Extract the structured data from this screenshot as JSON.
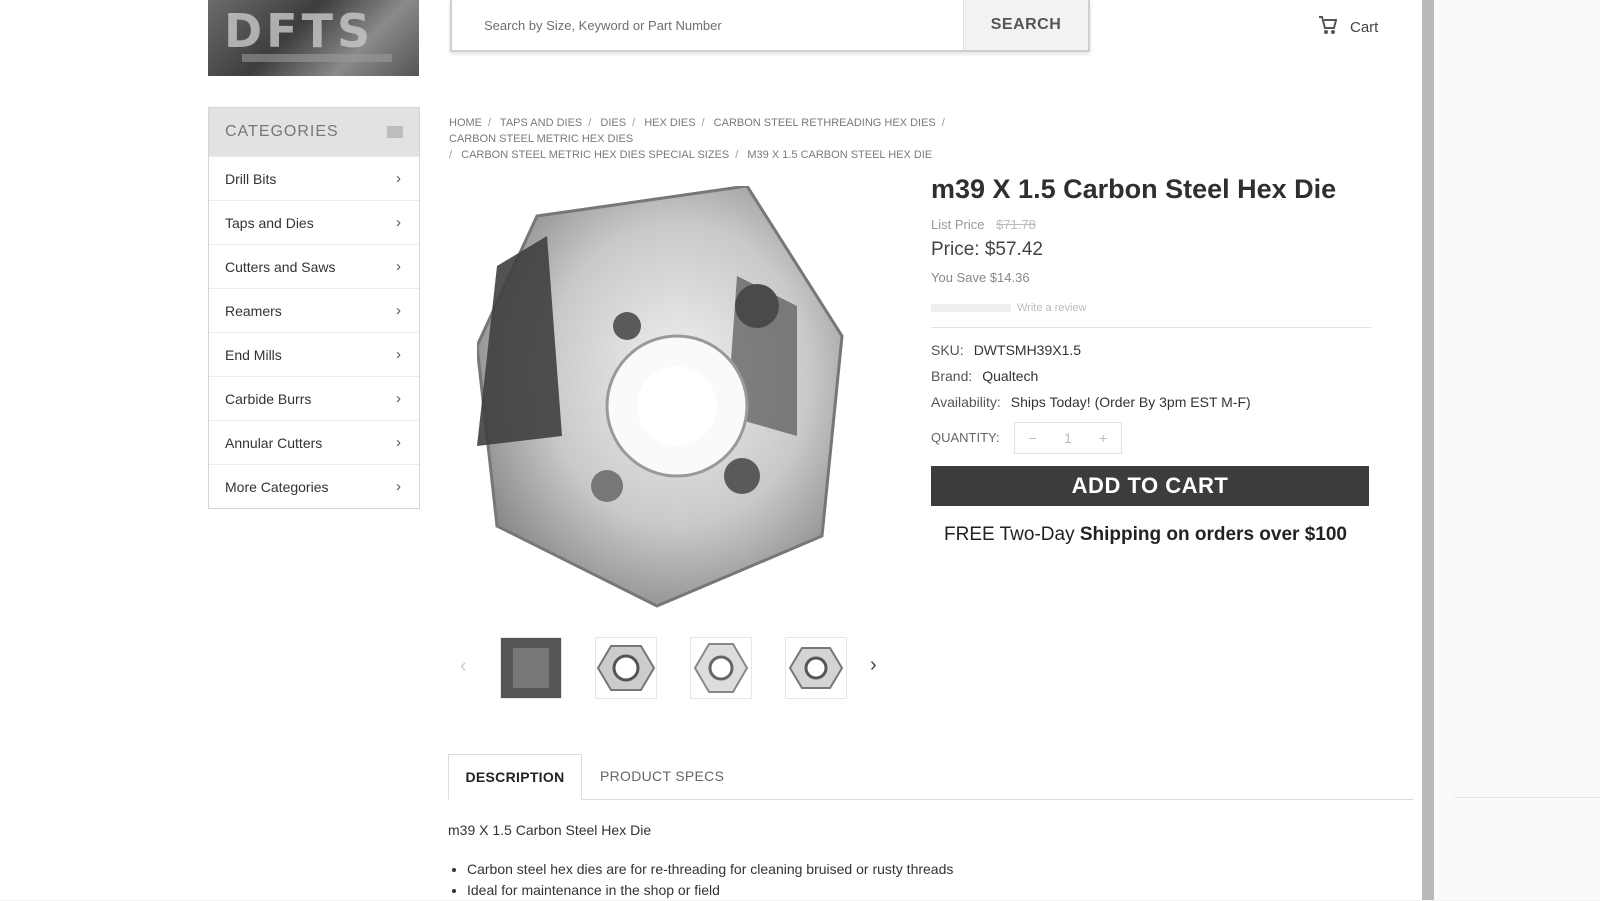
{
  "header": {
    "logo_text": "DFTS",
    "search": {
      "placeholder": "Search by Size, Keyword or Part Number",
      "button_label": "SEARCH"
    },
    "cart_label": "Cart"
  },
  "sidebar": {
    "title": "CATEGORIES",
    "items": [
      {
        "label": "Drill Bits"
      },
      {
        "label": "Taps and Dies"
      },
      {
        "label": "Cutters and Saws"
      },
      {
        "label": "Reamers"
      },
      {
        "label": "End Mills"
      },
      {
        "label": "Carbide Burrs"
      },
      {
        "label": "Annular Cutters"
      },
      {
        "label": "More Categories"
      }
    ]
  },
  "breadcrumb": [
    "Home",
    "Taps and Dies",
    "Dies",
    "Hex Dies",
    "Carbon Steel Rethreading Hex Dies",
    "Carbon Steel Metric Hex Dies",
    "Carbon Steel Metric Hex Dies Special Sizes",
    "M39 X 1.5 Carbon Steel Hex Die"
  ],
  "product": {
    "title": "m39 X 1.5 Carbon Steel Hex Die",
    "list_price_label": "List Price",
    "list_price_value": "$71.78",
    "price": "Price: $57.42",
    "you_save": "You Save $14.36",
    "reviews_link": "Write a review",
    "sku_label": "SKU:",
    "sku": "DWTSMH39X1.5",
    "brand_label": "Brand:",
    "brand": "Qualtech",
    "availability_label": "Availability:",
    "availability": "Ships Today! (Order By 3pm EST M-F)",
    "quantity_label": "QUANTITY:",
    "quantity": "1",
    "add_to_cart": "ADD TO CART",
    "free_shipping_prefix": "FREE Two-Day ",
    "free_shipping_bold": "Shipping on orders over $100"
  },
  "tabs": [
    {
      "label": "DESCRIPTION",
      "active": true
    },
    {
      "label": "PRODUCT SPECS",
      "active": false
    }
  ],
  "description": {
    "title": "m39 X 1.5 Carbon Steel Hex Die",
    "bullets": [
      "Carbon steel hex dies are for re-threading for cleaning bruised or rusty threads",
      "Ideal for maintenance in the shop or field"
    ]
  },
  "colors": {
    "accent_button": "#3c3c3c",
    "sidebar_header": "#e2e2e2"
  }
}
